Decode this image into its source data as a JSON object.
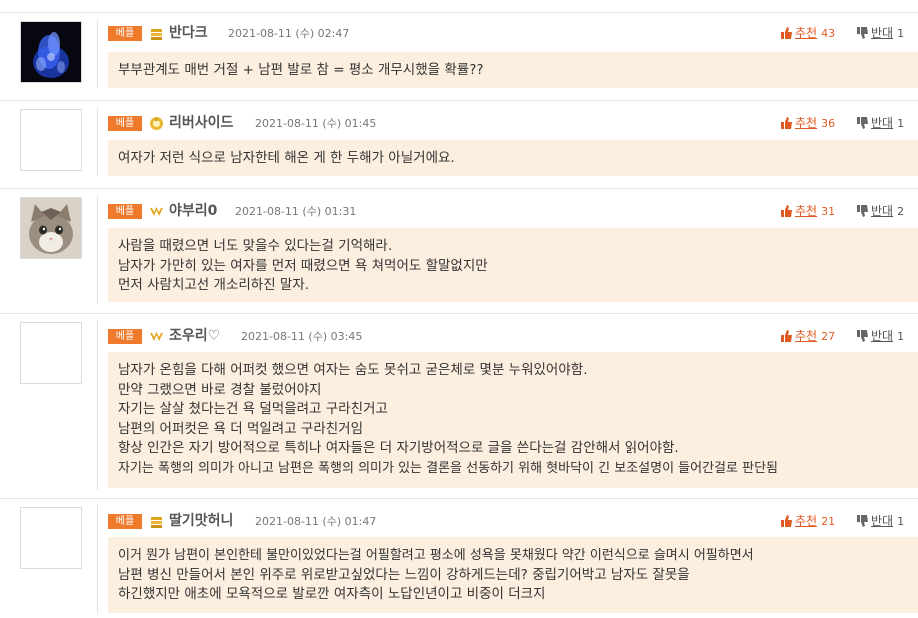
{
  "ui": {
    "best_label": "베플",
    "upvote_label": "추천",
    "downvote_label": "반대"
  },
  "comments": [
    {
      "nickname": "반다크",
      "date": "2021-08-11 (수) 02:47",
      "upvotes": "43",
      "downvotes": "1",
      "avatar": "blue-flame-image",
      "level_icon": "gold-stack-icon",
      "lines": [
        "부부관계도 매번 거절 + 남편 발로 참 = 평소 개무시했을 확률??"
      ]
    },
    {
      "nickname": "리버사이드",
      "date": "2021-08-11 (수) 01:45",
      "upvotes": "36",
      "downvotes": "1",
      "avatar": "blank-avatar",
      "level_icon": "gold-emblem-icon",
      "lines": [
        "여자가 저런 식으로 남자한테 해온 게 한 두해가 아닐거에요."
      ]
    },
    {
      "nickname": "야부리0",
      "date": "2021-08-11 (수) 01:31",
      "upvotes": "31",
      "downvotes": "2",
      "avatar": "cat-photo",
      "level_icon": "gold-wings-icon",
      "lines": [
        "사람을 때렸으면 너도 맞을수 있다는걸 기억해라.",
        "남자가 가만히 있는 여자를 먼저 때렸으면 욕 쳐먹어도 할말없지만",
        "먼저 사람치고선 개소리하진 말자."
      ]
    },
    {
      "nickname": "조우리♡",
      "date": "2021-08-11 (수) 03:45",
      "upvotes": "27",
      "downvotes": "1",
      "avatar": "blank-avatar",
      "level_icon": "gold-wings-icon",
      "lines": [
        "남자가 온힘을 다해 어퍼컷 했으면 여자는 숨도 못쉬고 굳은체로 몇분 누워있어야함.",
        "만약 그랬으면 바로 경찰 불렀어야지",
        "자기는 살살 쳤다는건 욕 덜먹을려고 구라친거고",
        "남편의 어퍼컷은 욕 더 먹일려고 구라친거임",
        "항상 인간은 자기 방어적으로 특히나 여자들은 더 자기방어적으로 글을 쓴다는걸 감안해서 읽어야함.",
        "자기는 폭행의 의미가 아니고 남편은 폭행의 의미가 있는 결론을 선동하기 위해 혓바닥이 긴 보조설명이 들어간걸로 판단됨"
      ]
    },
    {
      "nickname": "딸기맛허니",
      "date": "2021-08-11 (수) 01:47",
      "upvotes": "21",
      "downvotes": "1",
      "avatar": "blank-avatar",
      "level_icon": "gold-stack-icon",
      "lines": [
        "이거 뭔가 남편이 본인한테 불만이있었다는걸 어필할려고 평소에 성욕을 못채웠다 약간 이런식으로 슬며시 어필하면서",
        "남편 병신 만들어서 본인 위주로 위로받고싶었다는 느낌이 강하게드는데? 중립기어박고 남자도 잘못을",
        "하긴했지만 애초에 모욕적으로 발로깐 여자측이 노답인년이고 비중이 더크지"
      ]
    }
  ]
}
